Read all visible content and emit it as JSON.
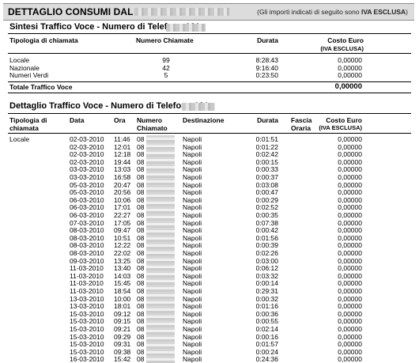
{
  "header": {
    "title": "DETTAGLIO CONSUMI DAL",
    "note_prefix": "(Gli importi indicati di seguito sono ",
    "note_bold": "IVA ESCLUSA",
    "note_suffix": ")"
  },
  "summary": {
    "title": "Sintesi Traffico Voce - Numero di Telefono 081",
    "col_type": "Tipologia di chiamata",
    "col_calls": "Numero Chiamate",
    "col_duration": "Durata",
    "col_cost": "Costo Euro",
    "col_cost_sub": "(IVA ESCLUSA)",
    "rows": [
      {
        "type": "Locale",
        "calls": "99",
        "duration": "8:28:43",
        "cost": "0,00000"
      },
      {
        "type": "Nazionale",
        "calls": "42",
        "duration": "9:16:40",
        "cost": "0,00000"
      },
      {
        "type": "Numeri Verdi",
        "calls": "5",
        "duration": "0:23:50",
        "cost": "0,00000"
      }
    ],
    "total_label": "Totale Traffico Voce",
    "total_value": "0,00000"
  },
  "detail": {
    "title": "Dettaglio Traffico Voce - Numero di Telefono 081",
    "col_type_1": "Tipologia di",
    "col_type_2": "chiamata",
    "col_date": "Data",
    "col_time": "Ora",
    "col_number_1": "Numero",
    "col_number_2": "Chiamato",
    "col_dest": "Destinazione",
    "col_duration": "Durata",
    "col_band_1": "Fascia",
    "col_band_2": "Oraria",
    "col_cost": "Costo Euro",
    "col_cost_sub": "(IVA ESCLUSA)",
    "type_value": "Locale",
    "rows": [
      {
        "date": "02-03-2010",
        "time": "11:46",
        "num": "08",
        "dest": "Napoli",
        "dur": "0:01:51",
        "cost": "0,00000"
      },
      {
        "date": "02-03-2010",
        "time": "12:01",
        "num": "08",
        "dest": "Napoli",
        "dur": "0:01:22",
        "cost": "0,00000"
      },
      {
        "date": "02-03-2010",
        "time": "12:18",
        "num": "08",
        "dest": "Napoli",
        "dur": "0:02:42",
        "cost": "0,00000"
      },
      {
        "date": "02-03-2010",
        "time": "19:44",
        "num": "08",
        "dest": "Napoli",
        "dur": "0:00:15",
        "cost": "0,00000"
      },
      {
        "date": "03-03-2010",
        "time": "13:03",
        "num": "08",
        "dest": "Napoli",
        "dur": "0:00:33",
        "cost": "0,00000"
      },
      {
        "date": "03-03-2010",
        "time": "16:58",
        "num": "08",
        "dest": "Napoli",
        "dur": "0:00:37",
        "cost": "0,00000"
      },
      {
        "date": "05-03-2010",
        "time": "20:47",
        "num": "08",
        "dest": "Napoli",
        "dur": "0:03:08",
        "cost": "0,00000"
      },
      {
        "date": "05-03-2010",
        "time": "20:56",
        "num": "08",
        "dest": "Napoli",
        "dur": "0:00:47",
        "cost": "0,00000"
      },
      {
        "date": "06-03-2010",
        "time": "10:06",
        "num": "08",
        "dest": "Napoli",
        "dur": "0:00:29",
        "cost": "0,00000"
      },
      {
        "date": "06-03-2010",
        "time": "17:01",
        "num": "08",
        "dest": "Napoli",
        "dur": "0:02:52",
        "cost": "0,00000"
      },
      {
        "date": "06-03-2010",
        "time": "22:27",
        "num": "08",
        "dest": "Napoli",
        "dur": "0:00:35",
        "cost": "0,00000"
      },
      {
        "date": "07-03-2010",
        "time": "17:05",
        "num": "08",
        "dest": "Napoli",
        "dur": "0:07:38",
        "cost": "0,00000"
      },
      {
        "date": "08-03-2010",
        "time": "09:47",
        "num": "08",
        "dest": "Napoli",
        "dur": "0:00:42",
        "cost": "0,00000"
      },
      {
        "date": "08-03-2010",
        "time": "10:51",
        "num": "08",
        "dest": "Napoli",
        "dur": "0:01:56",
        "cost": "0,00000"
      },
      {
        "date": "08-03-2010",
        "time": "12:22",
        "num": "08",
        "dest": "Napoli",
        "dur": "0:00:39",
        "cost": "0,00000"
      },
      {
        "date": "08-03-2010",
        "time": "22:02",
        "num": "08",
        "dest": "Napoli",
        "dur": "0:02:26",
        "cost": "0,00000"
      },
      {
        "date": "09-03-2010",
        "time": "13:25",
        "num": "08",
        "dest": "Napoli",
        "dur": "0:03:00",
        "cost": "0,00000"
      },
      {
        "date": "11-03-2010",
        "time": "13:40",
        "num": "08",
        "dest": "Napoli",
        "dur": "0:06:12",
        "cost": "0,00000"
      },
      {
        "date": "11-03-2010",
        "time": "14:03",
        "num": "08",
        "dest": "Napoli",
        "dur": "0:03:32",
        "cost": "0,00000"
      },
      {
        "date": "11-03-2010",
        "time": "15:45",
        "num": "08",
        "dest": "Napoli",
        "dur": "0:00:14",
        "cost": "0,00000"
      },
      {
        "date": "11-03-2010",
        "time": "18:54",
        "num": "08",
        "dest": "Napoli",
        "dur": "0:29:31",
        "cost": "0,00000"
      },
      {
        "date": "13-03-2010",
        "time": "10:00",
        "num": "08",
        "dest": "Napoli",
        "dur": "0:00:32",
        "cost": "0,00000"
      },
      {
        "date": "13-03-2010",
        "time": "18:01",
        "num": "08",
        "dest": "Napoli",
        "dur": "0:01:16",
        "cost": "0,00000"
      },
      {
        "date": "15-03-2010",
        "time": "09:12",
        "num": "08",
        "dest": "Napoli",
        "dur": "0:00:36",
        "cost": "0,00000"
      },
      {
        "date": "15-03-2010",
        "time": "09:15",
        "num": "08",
        "dest": "Napoli",
        "dur": "0:00:55",
        "cost": "0,00000"
      },
      {
        "date": "15-03-2010",
        "time": "09:21",
        "num": "08",
        "dest": "Napoli",
        "dur": "0:02:14",
        "cost": "0,00000"
      },
      {
        "date": "15-03-2010",
        "time": "09:29",
        "num": "08",
        "dest": "Napoli",
        "dur": "0:00:16",
        "cost": "0,00000"
      },
      {
        "date": "15-03-2010",
        "time": "09:31",
        "num": "08",
        "dest": "Napoli",
        "dur": "0:01:57",
        "cost": "0,00000"
      },
      {
        "date": "15-03-2010",
        "time": "09:38",
        "num": "08",
        "dest": "Napoli",
        "dur": "0:00:24",
        "cost": "0,00000"
      },
      {
        "date": "16-03-2010",
        "time": "15:42",
        "num": "08",
        "dest": "Napoli",
        "dur": "0:24:36",
        "cost": "0,00000"
      }
    ]
  }
}
